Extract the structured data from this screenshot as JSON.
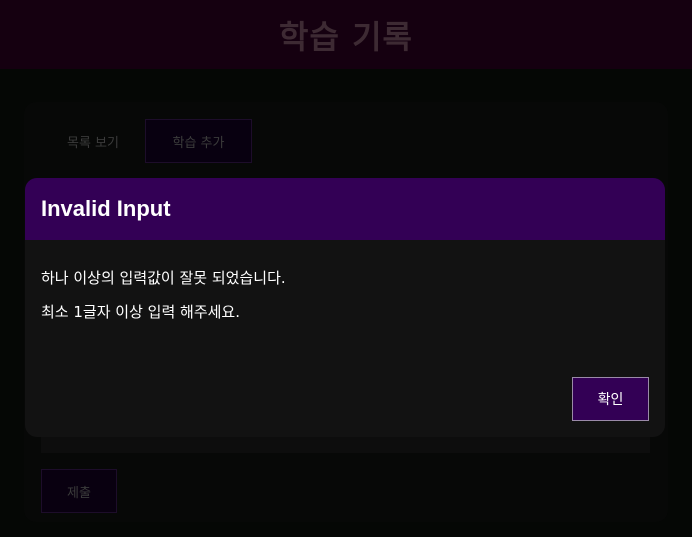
{
  "header": {
    "title": "학습 기록"
  },
  "tabs": [
    {
      "label": "목록 보기"
    },
    {
      "label": "학습 추가"
    }
  ],
  "form": {
    "submit_label": "제출"
  },
  "modal": {
    "title": "Invalid Input",
    "messages": [
      "하나 이상의 입력값이 잘못 되었습니다.",
      "최소 1글자 이상 입력 해주세요."
    ],
    "confirm_label": "확인"
  },
  "colors": {
    "accent": "#330055",
    "header_bg": "#150010",
    "modal_bg": "#121212"
  }
}
